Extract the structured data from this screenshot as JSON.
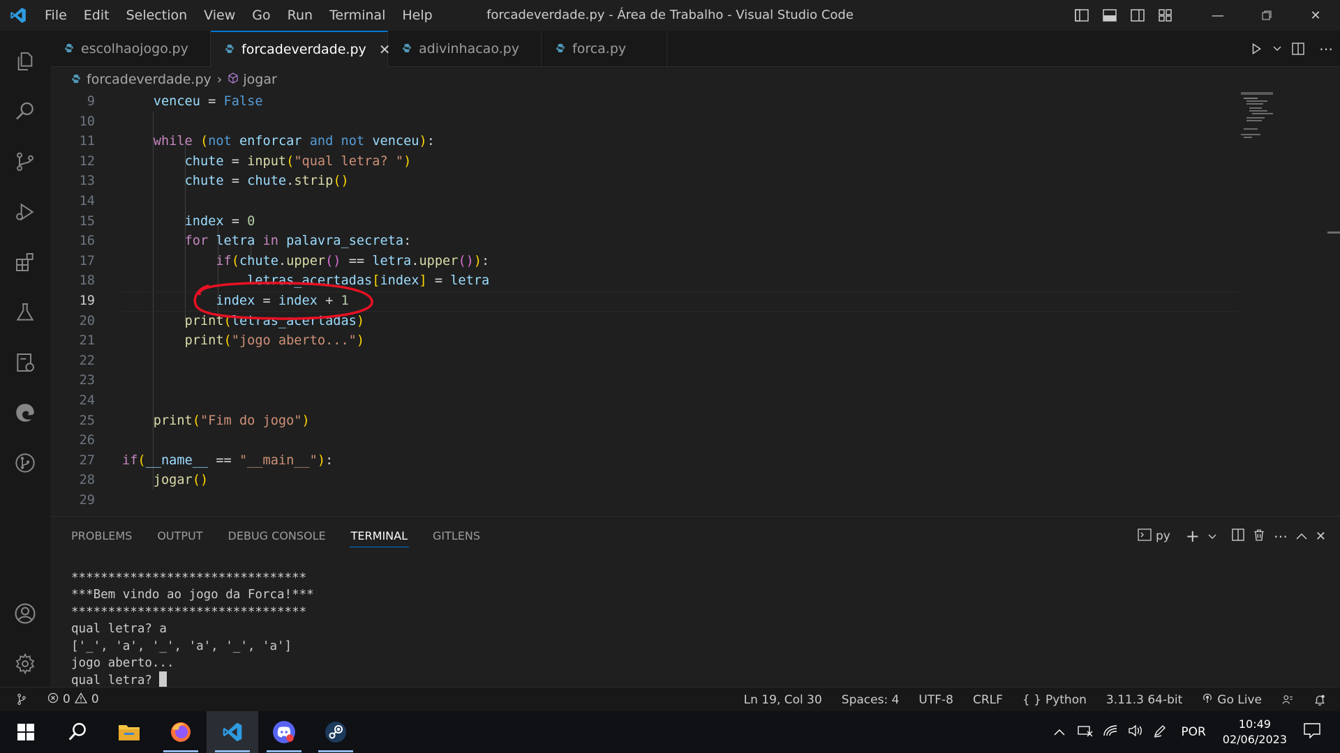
{
  "app": {
    "window_title": "forcadeverdade.py - Área de Trabalho - Visual Studio Code",
    "menu": [
      "File",
      "Edit",
      "Selection",
      "View",
      "Go",
      "Run",
      "Terminal",
      "Help"
    ]
  },
  "tabs": [
    {
      "label": "escolhaojogo.py",
      "active": false
    },
    {
      "label": "forcadeverdade.py",
      "active": true
    },
    {
      "label": "adivinhacao.py",
      "active": false
    },
    {
      "label": "forca.py",
      "active": false
    }
  ],
  "breadcrumb": {
    "file": "forcadeverdade.py",
    "symbol": "jogar"
  },
  "editor": {
    "line_numbers": [
      "9",
      "10",
      "11",
      "12",
      "13",
      "14",
      "15",
      "16",
      "17",
      "18",
      "19",
      "20",
      "21",
      "22",
      "23",
      "24",
      "25",
      "26",
      "27",
      "28",
      "29"
    ],
    "current_line": "19",
    "annotation": "red hand-drawn circle around line 19"
  },
  "panel": {
    "tabs": [
      "PROBLEMS",
      "OUTPUT",
      "DEBUG CONSOLE",
      "TERMINAL",
      "GITLENS"
    ],
    "active_tab": "TERMINAL",
    "terminal_name": "py",
    "terminal_lines": [
      "********************************",
      "***Bem vindo ao jogo da Forca!***",
      "********************************",
      "qual letra? a",
      "['_', 'a', '_', 'a', '_', 'a']",
      "jogo aberto...",
      "qual letra? "
    ]
  },
  "status": {
    "errors": "0",
    "warnings": "0",
    "position": "Ln 19, Col 30",
    "spaces": "Spaces: 4",
    "encoding": "UTF-8",
    "eol": "CRLF",
    "language": "Python",
    "interpreter": "3.11.3 64-bit",
    "golive": "Go Live"
  },
  "taskbar": {
    "language": "POR",
    "time": "10:49",
    "date": "02/06/2023"
  },
  "colors": {
    "accent": "#0078d4",
    "annotation": "#e81123"
  }
}
